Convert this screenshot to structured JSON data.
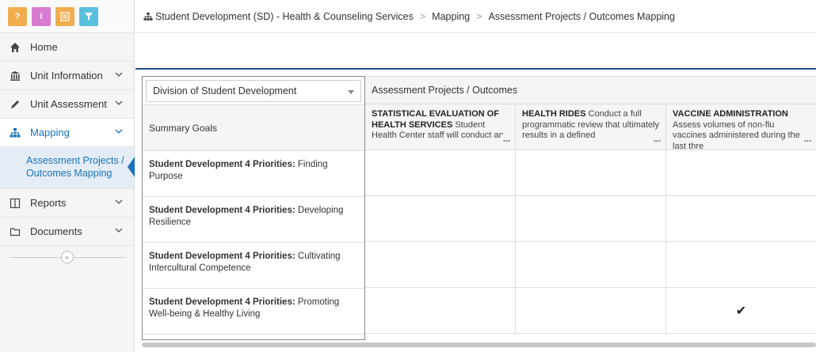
{
  "toolbar": {
    "buttons": [
      {
        "icon": "help-icon",
        "glyph": "?",
        "color": "#f0ad4e"
      },
      {
        "icon": "info-icon",
        "glyph": "i",
        "color": "#d97bd1"
      },
      {
        "icon": "notes-icon",
        "glyph": "",
        "color": "#f0ad4e"
      },
      {
        "icon": "filter-icon",
        "glyph": "",
        "color": "#5bc0de"
      }
    ]
  },
  "sidebar": {
    "items": [
      {
        "label": "Home",
        "icon": "home-icon"
      },
      {
        "label": "Unit Information",
        "icon": "institution-icon"
      },
      {
        "label": "Unit Assessment",
        "icon": "pencil-icon"
      },
      {
        "label": "Mapping",
        "icon": "sitemap-icon",
        "active": true
      },
      {
        "label": "Reports",
        "icon": "columns-icon"
      },
      {
        "label": "Documents",
        "icon": "folder-icon"
      }
    ],
    "subitem": "Assessment Projects / Outcomes Mapping",
    "collapse_glyph": "«"
  },
  "breadcrumb": {
    "root": "Student Development (SD) - Health & Counseling Services",
    "mid": "Mapping",
    "current": "Assessment Projects / Outcomes Mapping",
    "sep": ">"
  },
  "grid": {
    "division_select": "Division of Student Development",
    "summary_header": "Summary Goals",
    "projects_header": "Assessment Projects / Outcomes",
    "goal_prefix": "Student Development 4 Priorities:",
    "goals": [
      " Finding Purpose",
      " Developing Resilience",
      " Cultivating Intercultural Competence",
      " Promoting Well-being & Healthy Living"
    ],
    "projects": [
      {
        "title": "STATISTICAL EVALUATION OF HEALTH SERVICES",
        "desc": " Student Health Center staff will conduct an"
      },
      {
        "title": "HEALTH RIDES",
        "desc": " Conduct a full programmatic review that ultimately results in a defined"
      },
      {
        "title": "VACCINE ADMINISTRATION",
        "desc": " Assess volumes of non-flu vaccines administered during the last thre"
      }
    ],
    "more": "...",
    "check": "✔",
    "colors": {
      "accent": "#1a73b8",
      "rule": "#1f4f8a"
    }
  }
}
